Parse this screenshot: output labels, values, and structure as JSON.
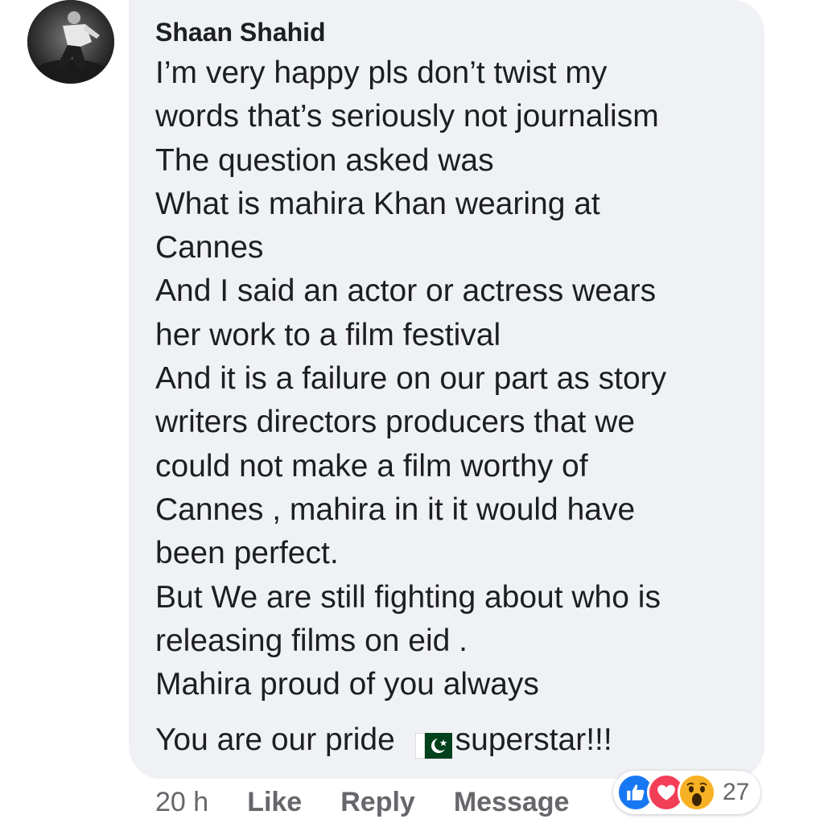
{
  "comment": {
    "author": "Shaan Shahid",
    "lines": [
      "I’m very happy pls don’t twist my",
      "words that’s seriously not journalism",
      "The question asked was",
      "What is mahira Khan wearing at",
      "Cannes",
      "And I said an actor or actress wears",
      "her work to a film festival",
      "And it is a failure on our part as story",
      "writers directors producers that we",
      "could not make a film worthy of",
      "Cannes , mahira in it it would have",
      "been perfect.",
      "But We are still fighting about who is",
      "releasing films on eid .",
      "Mahira proud of you always"
    ],
    "last_line_before": "You are our pride ",
    "last_line_after": "superstar!!!"
  },
  "actions": {
    "time": "20 h",
    "like": "Like",
    "reply": "Reply",
    "message": "Message"
  },
  "reactions": {
    "types": [
      "like-icon",
      "love-icon",
      "wow-icon"
    ],
    "count": "27"
  },
  "colors": {
    "bubble": "#f0f1f4",
    "like": "#1877f2",
    "love": "#f33e58",
    "wow": "#f7b125",
    "flag_green": "#01411c"
  }
}
